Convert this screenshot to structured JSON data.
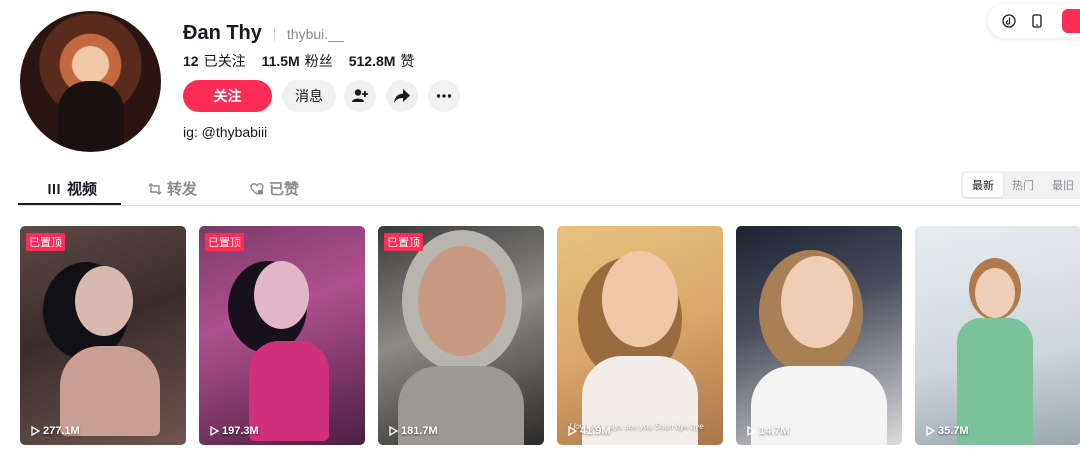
{
  "profile": {
    "display_name": "Đan Thy",
    "handle": "thybui.__",
    "bio": "ig: @thybabiii",
    "stats": [
      {
        "num": "12",
        "label": "已关注"
      },
      {
        "num": "11.5M",
        "label": "粉丝"
      },
      {
        "num": "512.8M",
        "label": "赞"
      }
    ]
  },
  "actions": {
    "follow_label": "关注",
    "message_label": "消息",
    "add_friend_icon": "add-user-icon",
    "share_icon": "share-icon",
    "more_icon": "more-icon"
  },
  "topbar": {
    "icons": [
      "tiktok-icon",
      "phone-icon"
    ]
  },
  "tabs": [
    {
      "label": "视频",
      "icon": "grid-icon",
      "active": true
    },
    {
      "label": "转发",
      "icon": "repost-icon",
      "active": false
    },
    {
      "label": "已赞",
      "icon": "heart-icon",
      "active": false
    }
  ],
  "sort": [
    "最新",
    "热门",
    "最旧"
  ],
  "videos": [
    {
      "pinned": "已置顶",
      "views": "277.1M"
    },
    {
      "pinned": "已置顶",
      "views": "197.3M"
    },
    {
      "pinned": "已置顶",
      "views": "181.7M"
    },
    {
      "pinned": "",
      "views": "41.9M",
      "caption": "I love you guys see you Soon bye bye"
    },
    {
      "pinned": "",
      "views": "14.7M"
    },
    {
      "pinned": "",
      "views": "35.7M"
    }
  ],
  "colors": {
    "accent": "#fe2c55",
    "text": "#161823",
    "muted": "#8a8b91"
  }
}
